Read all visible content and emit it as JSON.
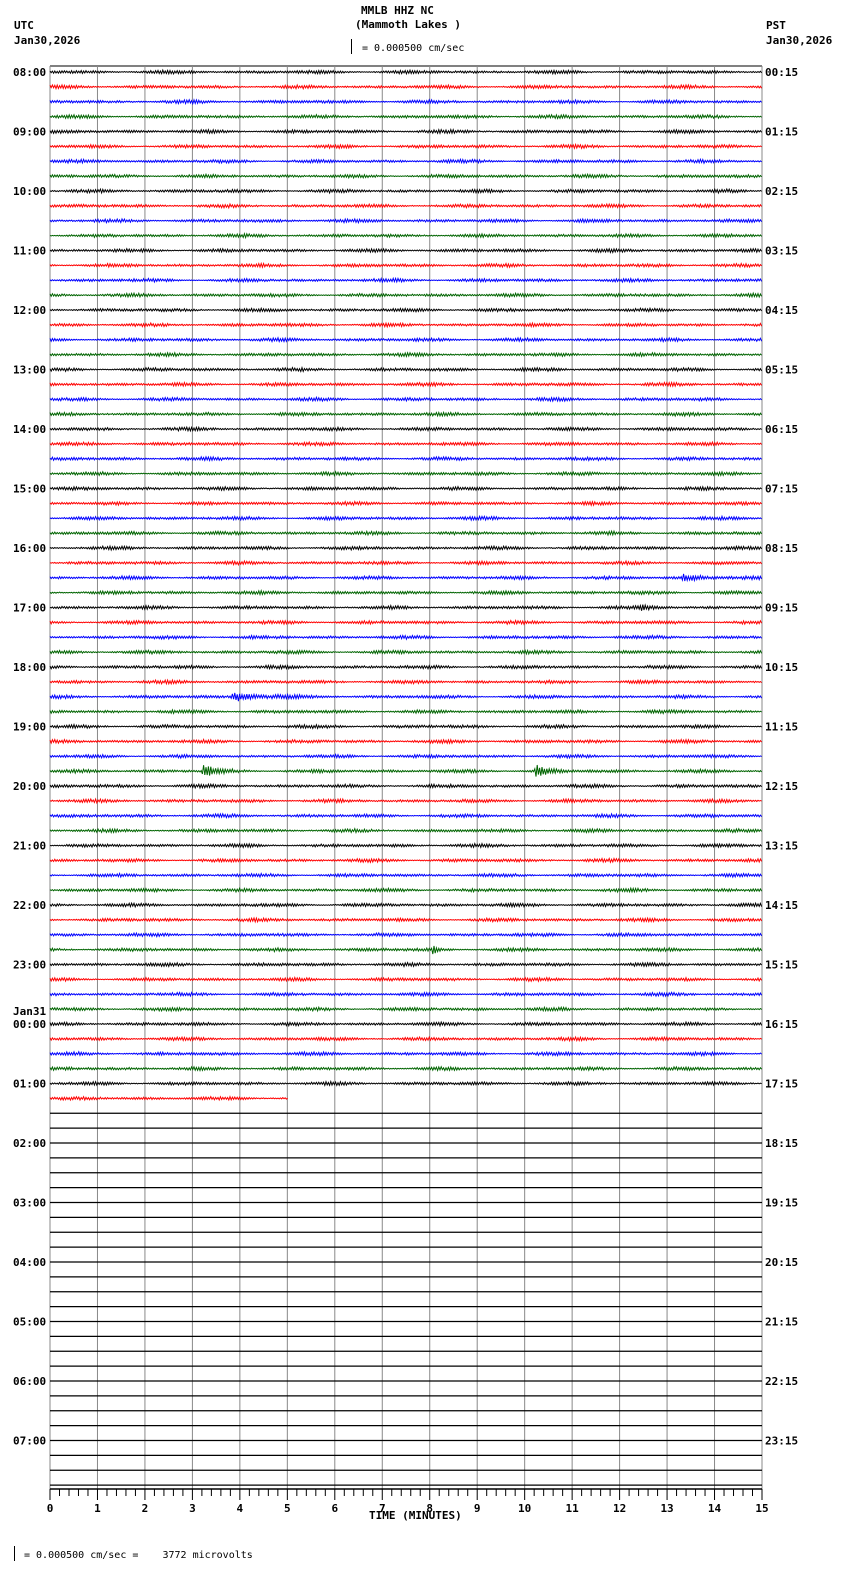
{
  "header": {
    "station": "MMLB HHZ NC",
    "location": "(Mammoth Lakes )",
    "left_tz": "UTC",
    "left_date": "Jan30,2026",
    "right_tz": "PST",
    "right_date": "Jan30,2026",
    "scale_label": "= 0.000500 cm/sec"
  },
  "footer": {
    "scale_note": "= 0.000500 cm/sec =    3772 microvolts"
  },
  "chart_data": {
    "type": "line",
    "title": "MMLB HHZ NC (Mammoth Lakes )",
    "xlabel": "TIME (MINUTES)",
    "xlim": [
      0,
      15
    ],
    "x_ticks": [
      "0",
      "1",
      "2",
      "3",
      "4",
      "5",
      "6",
      "7",
      "8",
      "9",
      "10",
      "11",
      "12",
      "13",
      "14",
      "15"
    ],
    "rows_per_hour": 4,
    "total_rows": 96,
    "trace_colors": [
      "#000000",
      "#ff0000",
      "#0000ff",
      "#006400"
    ],
    "data_end": {
      "row": 69,
      "minute": 5
    },
    "left_labels": [
      {
        "row": 0,
        "text": "08:00"
      },
      {
        "row": 4,
        "text": "09:00"
      },
      {
        "row": 8,
        "text": "10:00"
      },
      {
        "row": 12,
        "text": "11:00"
      },
      {
        "row": 16,
        "text": "12:00"
      },
      {
        "row": 20,
        "text": "13:00"
      },
      {
        "row": 24,
        "text": "14:00"
      },
      {
        "row": 28,
        "text": "15:00"
      },
      {
        "row": 32,
        "text": "16:00"
      },
      {
        "row": 36,
        "text": "17:00"
      },
      {
        "row": 40,
        "text": "18:00"
      },
      {
        "row": 44,
        "text": "19:00"
      },
      {
        "row": 48,
        "text": "20:00"
      },
      {
        "row": 52,
        "text": "21:00"
      },
      {
        "row": 56,
        "text": "22:00"
      },
      {
        "row": 60,
        "text": "23:00"
      },
      {
        "row": 64,
        "text": "00:00",
        "date": "Jan31"
      },
      {
        "row": 68,
        "text": "01:00"
      },
      {
        "row": 72,
        "text": "02:00"
      },
      {
        "row": 76,
        "text": "03:00"
      },
      {
        "row": 80,
        "text": "04:00"
      },
      {
        "row": 84,
        "text": "05:00"
      },
      {
        "row": 88,
        "text": "06:00"
      },
      {
        "row": 92,
        "text": "07:00"
      }
    ],
    "right_labels": [
      "00:15",
      "01:15",
      "02:15",
      "03:15",
      "04:15",
      "05:15",
      "06:15",
      "07:15",
      "08:15",
      "09:15",
      "10:15",
      "11:15",
      "12:15",
      "13:15",
      "14:15",
      "15:15",
      "16:15",
      "17:15",
      "18:15",
      "19:15",
      "20:15",
      "21:15",
      "22:15",
      "23:15"
    ],
    "events": [
      {
        "row": 34,
        "start": 13.3,
        "end": 14.4,
        "amp": 4
      },
      {
        "row": 36,
        "start": 12.4,
        "end": 13.2,
        "amp": 2.5
      },
      {
        "row": 42,
        "start": 3.8,
        "end": 5.6,
        "amp": 5
      },
      {
        "row": 47,
        "start": 3.2,
        "end": 4.0,
        "amp": 6
      },
      {
        "row": 47,
        "start": 10.2,
        "end": 10.8,
        "amp": 8
      },
      {
        "row": 59,
        "start": 8.05,
        "end": 8.25,
        "amp": 6
      }
    ]
  }
}
